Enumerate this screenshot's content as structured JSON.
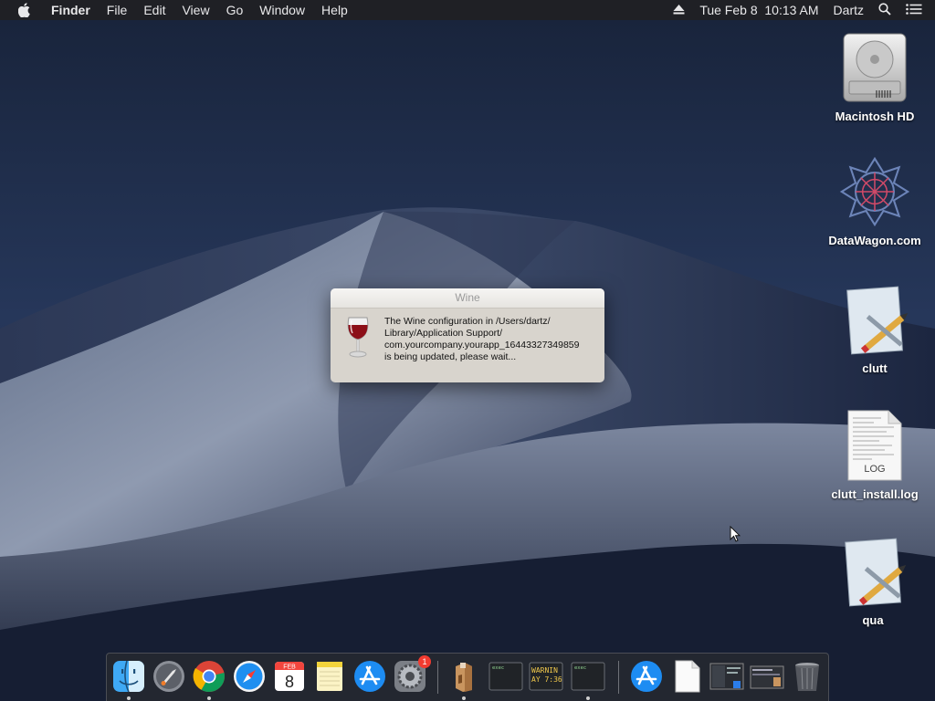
{
  "menubar": {
    "app_name": "Finder",
    "menus": [
      "File",
      "Edit",
      "View",
      "Go",
      "Window",
      "Help"
    ],
    "datetime": "Tue Feb 8  10:13 AM",
    "user": "Dartz",
    "icons": [
      "apple-icon",
      "eject-icon",
      "spotlight-search-icon",
      "notification-center-icon"
    ]
  },
  "desktop": {
    "icons": [
      {
        "label": "Macintosh HD",
        "icon": "hard-drive-icon"
      },
      {
        "label": "DataWagon.com",
        "icon": "datawagon-logo-icon"
      },
      {
        "label": "clutt",
        "icon": "app-document-icon"
      },
      {
        "label": "clutt_install.log",
        "icon": "log-file-icon",
        "badge": "LOG"
      },
      {
        "label": "qua",
        "icon": "app-document-icon"
      }
    ]
  },
  "dialog": {
    "title": "Wine",
    "icon": "wine-glass-icon",
    "message_lines": [
      "The Wine configuration in /Users/dartz/",
      "Library/Application Support/",
      "com.yourcompany.yourapp_16443327349859",
      "is being updated, please wait..."
    ]
  },
  "dock": {
    "items": [
      {
        "name": "finder-icon",
        "running": true
      },
      {
        "name": "launchpad-icon",
        "running": false
      },
      {
        "name": "chrome-icon",
        "running": true
      },
      {
        "name": "safari-icon",
        "running": false
      },
      {
        "name": "calendar-icon",
        "running": false,
        "month": "FEB",
        "day": "8"
      },
      {
        "name": "notes-icon",
        "running": false
      },
      {
        "name": "app-store-icon",
        "running": false
      },
      {
        "name": "system-preferences-icon",
        "running": false,
        "badge": "1"
      },
      {
        "name": "wine-app-icon",
        "running": true
      },
      {
        "name": "terminal-exec-icon",
        "running": false,
        "text": "exec"
      },
      {
        "name": "console-warning-icon",
        "running": false,
        "text": "WARNIN",
        "subtext": "AY 7:36"
      },
      {
        "name": "terminal-exec-icon",
        "running": true,
        "text": "exec"
      },
      {
        "name": "app-store-folder-icon",
        "running": false
      },
      {
        "name": "document-icon",
        "running": false
      },
      {
        "name": "screenshot-icon",
        "running": false
      },
      {
        "name": "screenshot-icon",
        "running": false
      },
      {
        "name": "trash-icon",
        "running": false
      }
    ]
  },
  "colors": {
    "menubar_bg": "#1f2025",
    "dialog_bg": "#d8d4cd",
    "wallpaper_sky": "#1b2740"
  }
}
